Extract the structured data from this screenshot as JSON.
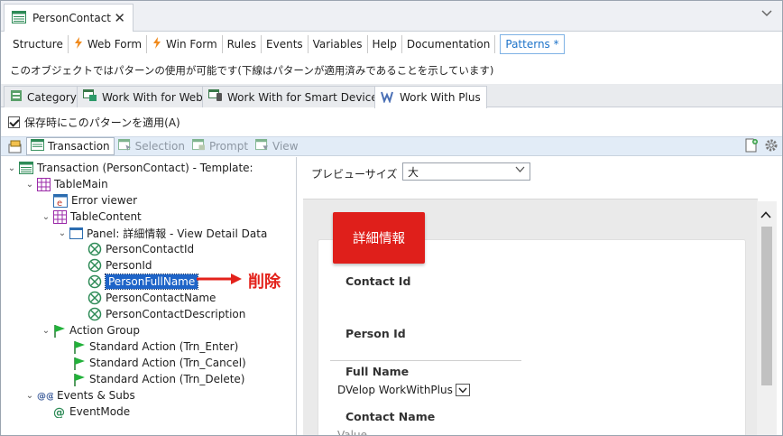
{
  "window": {
    "doc_tab": "PersonContact",
    "close_glyph": "✕"
  },
  "subtabs": [
    {
      "label": "Structure",
      "icon": ""
    },
    {
      "label": "Web Form",
      "icon": "webform-icon"
    },
    {
      "label": "Win Form",
      "icon": "winform-icon"
    },
    {
      "label": "Rules",
      "icon": ""
    },
    {
      "label": "Events",
      "icon": ""
    },
    {
      "label": "Variables",
      "icon": ""
    },
    {
      "label": "Help",
      "icon": ""
    },
    {
      "label": "Documentation",
      "icon": ""
    },
    {
      "label": "Patterns *",
      "icon": "",
      "active": true
    }
  ],
  "info_text": "このオブジェクトではパターンの使用が可能です(下線はパターンが適用済みであることを示しています)",
  "pattern_tabs": [
    {
      "label": "Category"
    },
    {
      "label": "Work With for Web"
    },
    {
      "label": "Work With for Smart Devices"
    },
    {
      "label": "Work With Plus",
      "active": true
    }
  ],
  "apply_checkbox": {
    "label": "保存時にこのパターンを適用(A)",
    "checked": true
  },
  "toolbar": {
    "transaction": "Transaction",
    "selection": "Selection",
    "prompt": "Prompt",
    "view": "View"
  },
  "tree": {
    "root": "Transaction (PersonContact) - Template:",
    "table_main": "TableMain",
    "error_viewer": "Error viewer",
    "table_content": "TableContent",
    "panel": "Panel: 詳細情報 - View Detail Data",
    "attributes": [
      "PersonContactId",
      "PersonId",
      "PersonFullName",
      "PersonContactName",
      "PersonContactDescription"
    ],
    "selected_attribute": "PersonFullName",
    "action_group": "Action Group",
    "actions": [
      "Standard Action (Trn_Enter)",
      "Standard Action (Trn_Cancel)",
      "Standard Action (Trn_Delete)"
    ],
    "events_subs": "Events & Subs",
    "event_mode": "EventMode"
  },
  "callout": {
    "text": "削除",
    "color": "#e3221b"
  },
  "preview": {
    "size_label": "プレビューサイズ",
    "size_value": "大",
    "badge": "詳細情報",
    "badge_color": "#df1f1b",
    "fields": {
      "contact_id": "Contact Id",
      "person_id": "Person Id",
      "person_id_value": "DVelop WorkWithPlus",
      "full_name": "Full Name",
      "full_name_placeholder": "Value",
      "contact_name": "Contact Name"
    }
  },
  "colors": {
    "accent": "#1d73c9",
    "selection": "#1e64c8",
    "toolbar_bg": "#e2ecf7"
  }
}
